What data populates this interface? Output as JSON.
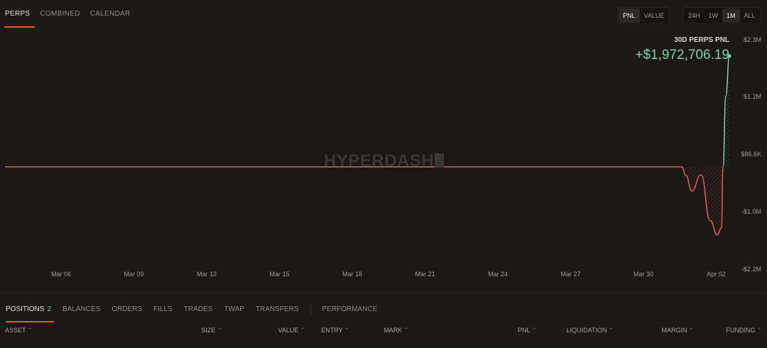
{
  "top_tabs": [
    {
      "label": "PERPS",
      "active": true
    },
    {
      "label": "COMBINED",
      "active": false
    },
    {
      "label": "CALENDAR",
      "active": false
    }
  ],
  "metric_toggle": [
    {
      "label": "PNL",
      "active": true
    },
    {
      "label": "VALUE",
      "active": false
    }
  ],
  "range_toggle": [
    {
      "label": "24H",
      "active": false
    },
    {
      "label": "1W",
      "active": false
    },
    {
      "label": "1M",
      "active": true
    },
    {
      "label": "ALL",
      "active": false
    }
  ],
  "summary": {
    "title": "30D PERPS PNL",
    "value": "+$1,972,706.19"
  },
  "watermark": "HYPERDASH",
  "colors": {
    "background": "#1c1816",
    "accent": "#e25a2a",
    "positive": "#7fd1a8",
    "negative": "#d9605f"
  },
  "chart_data": {
    "type": "area",
    "title": "30D PERPS PNL",
    "xlabel": "",
    "ylabel": "",
    "x_ticks": [
      "Mar 06",
      "Mar 09",
      "Mar 12",
      "Mar 15",
      "Mar 18",
      "Mar 21",
      "Mar 24",
      "Mar 27",
      "Mar 30",
      "Apr 02"
    ],
    "y_ticks": [
      "$2.3M",
      "$1.2M",
      "$86.6K",
      "-$1.0M",
      "-$2.2M"
    ],
    "y_tick_values": [
      2300000,
      1200000,
      86600,
      -1000000,
      -2200000
    ],
    "ylim": [
      -2200000,
      2300000
    ],
    "x_start": "Mar 03",
    "x_end": "Apr 03",
    "baseline": 0,
    "grid": false,
    "series": [
      {
        "x": [
          "Mar 03",
          "Mar 10",
          "Mar 17",
          "Mar 24",
          "Mar 31",
          "Apr 01",
          "Apr 01 06h",
          "Apr 01 12h",
          "Apr 01 18h",
          "Apr 02",
          "Apr 02 06h",
          "Apr 02 12h",
          "Apr 02 18h",
          "Apr 03"
        ],
        "values": [
          0,
          0,
          0,
          0,
          0,
          0,
          -200000,
          -550000,
          -180000,
          -1200000,
          -1500000,
          -1350000,
          1200000,
          1972706
        ]
      }
    ]
  },
  "bottom_tabs": [
    {
      "label": "POSITIONS",
      "count": "2",
      "active": true
    },
    {
      "label": "BALANCES",
      "active": false
    },
    {
      "label": "ORDERS",
      "active": false
    },
    {
      "label": "FILLS",
      "active": false
    },
    {
      "label": "TRADES",
      "active": false
    },
    {
      "label": "TWAP",
      "active": false
    },
    {
      "label": "TRANSFERS",
      "active": false
    },
    {
      "label": "PERFORMANCE",
      "active": false
    }
  ],
  "table": {
    "columns": [
      "ASSET",
      "SIZE",
      "VALUE",
      "ENTRY",
      "MARK",
      "PNL",
      "LIQUIDATION",
      "MARGIN",
      "FUNDING"
    ],
    "sort_icon": "sort-icon"
  }
}
